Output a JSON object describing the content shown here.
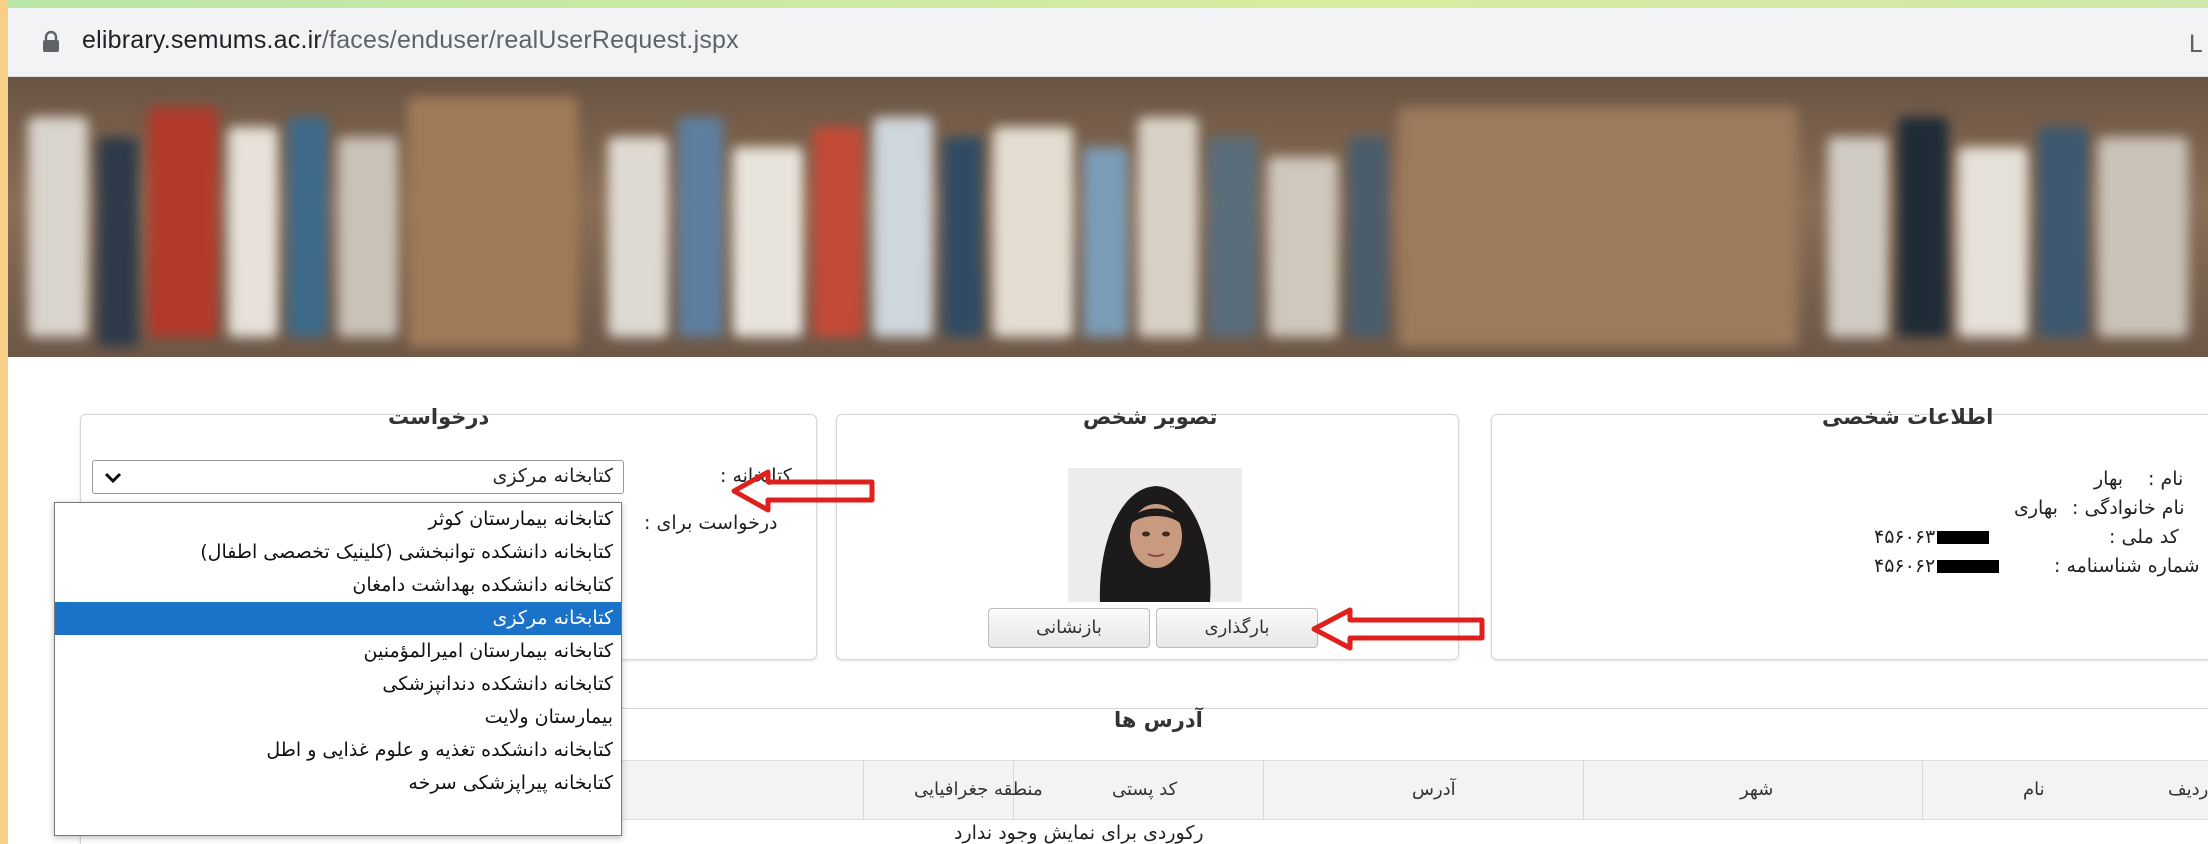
{
  "browser": {
    "url_host": "elibrary.semums.ac.ir",
    "url_path": "/faces/enduser/realUserRequest.jspx",
    "edge_char": "L"
  },
  "request_panel": {
    "title": "درخواست",
    "library_label": "کتابخانه :",
    "library_selected": "کتابخانه مرکزی",
    "request_for_label": "درخواست برای :",
    "options": [
      {
        "label": "کتابخانه بیمارستان کوثر",
        "selected": false
      },
      {
        "label": "کتابخانه دانشکده توانبخشی (کلینیک تخصصی اطفال)",
        "selected": false
      },
      {
        "label": "کتابخانه دانشکده بهداشت دامغان",
        "selected": false
      },
      {
        "label": "کتابخانه مرکزی",
        "selected": true
      },
      {
        "label": "کتابخانه بیمارستان امیرالمؤمنین",
        "selected": false
      },
      {
        "label": "کتابخانه دانشکده دندانپزشکی",
        "selected": false
      },
      {
        "label": "بیمارستان ولایت",
        "selected": false
      },
      {
        "label": "کتابخانه دانشکده تغذیه و علوم غذایی و اطل",
        "selected": false
      },
      {
        "label": "کتابخانه پیراپزشکی سرخه",
        "selected": false
      }
    ]
  },
  "photo_panel": {
    "title": "تصویر شخص",
    "upload_button": "بارگذاری",
    "reset_button": "بازنشانی"
  },
  "personal_panel": {
    "title": "اطلاعات شخصی",
    "first_name_label": "نام :",
    "first_name": "بهار",
    "last_name_label": "نام خانوادگی :",
    "last_name": "بهاری",
    "national_code_label": "کد ملی :",
    "national_code": "۴۵۶۰۶۳",
    "id_number_label": "شماره شناسنامه :",
    "id_number": "۴۵۶۰۶۲"
  },
  "addresses": {
    "title": "آدرس ها",
    "columns": [
      "ردیف",
      "نام",
      "شهر",
      "آدرس",
      "کد پستی",
      "منطقه جغرافیایی"
    ],
    "empty_message": "رکوردی برای نمایش وجود ندارد"
  },
  "colors": {
    "selected_option": "#1a73c9",
    "annotation_arrow": "#e0201c",
    "page_frame": "#f7cf86"
  }
}
